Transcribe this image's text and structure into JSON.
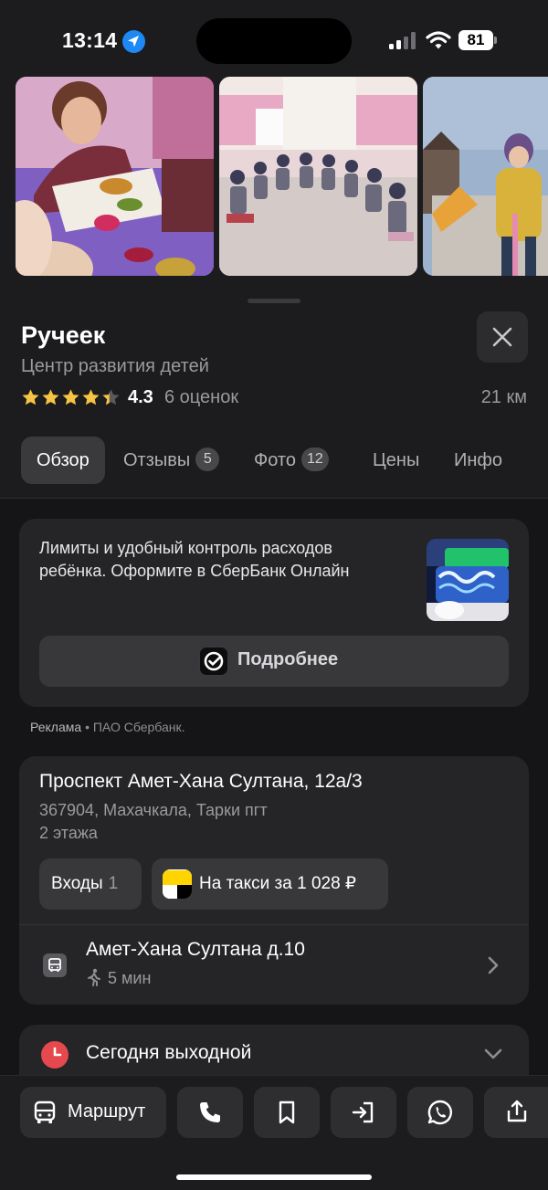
{
  "status_bar": {
    "time": "13:14",
    "battery": "81"
  },
  "place": {
    "name": "Ручеек",
    "category": "Центр развития детей",
    "rating": "4.3",
    "rating_count": "6 оценок",
    "distance": "21 км",
    "rating_stars": 4.3
  },
  "tabs": [
    {
      "label": "Обзор",
      "badge": ""
    },
    {
      "label": "Отзывы",
      "badge": "5"
    },
    {
      "label": "Фото",
      "badge": "12"
    },
    {
      "label": "Цены",
      "badge": ""
    },
    {
      "label": "Инфо",
      "badge": ""
    }
  ],
  "ad": {
    "text": "Лимиты и удобный контроль расходов ребёнка. Оформите в СберБанк Онлайн",
    "button": "Подробнее",
    "caption_label": "Реклама",
    "caption_sep": "•",
    "caption_advertiser": "ПАО Сбербанк."
  },
  "address": {
    "street": "Проспект Амет-Хана Султана, 12а/3",
    "locality": "367904, Махачкала, Тарки пгт",
    "floors": "2 этажа",
    "entrances_label": "Входы",
    "entrances_count": "1",
    "taxi_label": "На такси за 1 028 ₽",
    "stop_name": "Амет-Хана Султана д.10",
    "walk_time": "5 мин"
  },
  "hours": {
    "status": "Сегодня выходной"
  },
  "actions": {
    "route": "Маршрут"
  },
  "colors": {
    "accent_blue": "#1e88f5",
    "star": "#f6c343",
    "closed_red": "#e5484d",
    "taxi_yellow": "#ffd400"
  }
}
